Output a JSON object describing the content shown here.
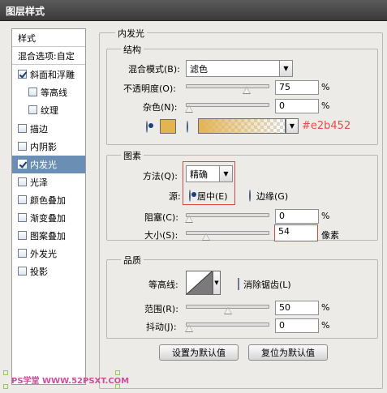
{
  "window": {
    "title": "图层样式"
  },
  "sidebar": {
    "items": [
      {
        "label": "样式",
        "checkbox": false,
        "checked": false
      },
      {
        "label": "混合选项:自定",
        "checkbox": false,
        "checked": false
      },
      {
        "label": "斜面和浮雕",
        "checkbox": true,
        "checked": true
      },
      {
        "label": "等高线",
        "checkbox": true,
        "checked": false
      },
      {
        "label": "纹理",
        "checkbox": true,
        "checked": false
      },
      {
        "label": "描边",
        "checkbox": true,
        "checked": false
      },
      {
        "label": "内阴影",
        "checkbox": true,
        "checked": false
      },
      {
        "label": "内发光",
        "checkbox": true,
        "checked": true
      },
      {
        "label": "光泽",
        "checkbox": true,
        "checked": false
      },
      {
        "label": "颜色叠加",
        "checkbox": true,
        "checked": false
      },
      {
        "label": "渐变叠加",
        "checkbox": true,
        "checked": false
      },
      {
        "label": "图案叠加",
        "checkbox": true,
        "checked": false
      },
      {
        "label": "外发光",
        "checkbox": true,
        "checked": false
      },
      {
        "label": "投影",
        "checkbox": true,
        "checked": false
      }
    ]
  },
  "panel": {
    "title": "内发光",
    "structure": {
      "title": "结构",
      "blend_mode_label": "混合模式(B):",
      "blend_mode_value": "滤色",
      "opacity_label": "不透明度(O):",
      "opacity_value": "75",
      "opacity_level": 0.75,
      "noise_label": "杂色(N):",
      "noise_value": "0",
      "noise_level": 0,
      "hex_label": "#e2b452",
      "color": "#e2b452"
    },
    "elements": {
      "title": "图素",
      "method_label": "方法(Q):",
      "method_value": "精确",
      "source_label": "源:",
      "source_center_label": "居中(E)",
      "source_edge_label": "边缘(G)",
      "choke_label": "阻塞(C):",
      "choke_value": "0",
      "choke_level": 0,
      "size_label": "大小(S):",
      "size_value": "54",
      "size_level": 0.22,
      "size_unit": "像素"
    },
    "quality": {
      "title": "品质",
      "contour_label": "等高线:",
      "antialias_label": "消除锯齿(L)",
      "range_label": "范围(R):",
      "range_value": "50",
      "range_level": 0.5,
      "jitter_label": "抖动(J):",
      "jitter_value": "0",
      "jitter_level": 0
    },
    "percent": "%",
    "buttons": {
      "make_default": "设置为默认值",
      "reset_default": "复位为默认值"
    }
  },
  "watermark": "PS学堂 WWW.52PSXT.COM"
}
